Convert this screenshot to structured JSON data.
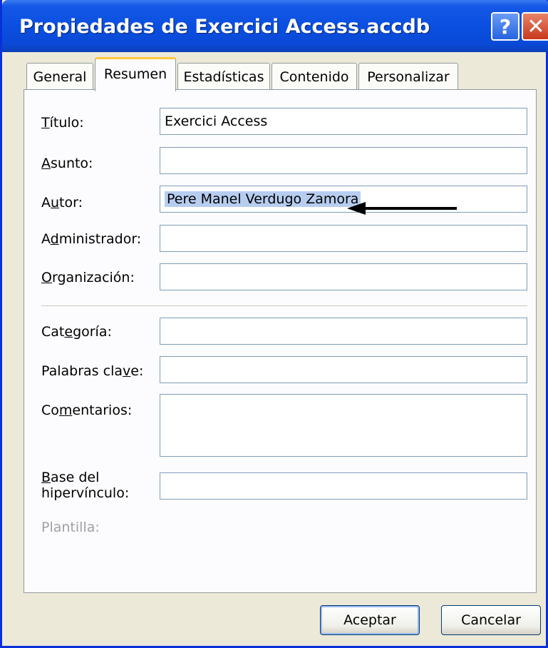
{
  "window": {
    "title": "Propiedades de Exercici Access.accdb",
    "help_glyph": "?",
    "close_glyph": "✕"
  },
  "tabs": [
    "General",
    "Resumen",
    "Estadísticas",
    "Contenido",
    "Personalizar"
  ],
  "fields": {
    "titulo": {
      "label_pre": "",
      "label_u": "T",
      "label_post": "ítulo:",
      "value": "Exercici Access"
    },
    "asunto": {
      "label_pre": "",
      "label_u": "A",
      "label_post": "sunto:",
      "value": ""
    },
    "autor": {
      "label_pre": "A",
      "label_u": "u",
      "label_post": "tor:",
      "value": "Pere Manel Verdugo Zamora"
    },
    "admin": {
      "label_pre": "A",
      "label_u": "d",
      "label_post": "ministrador:",
      "value": ""
    },
    "org": {
      "label_pre": "",
      "label_u": "O",
      "label_post": "rganización:",
      "value": ""
    },
    "categoria": {
      "label_pre": "Cat",
      "label_u": "e",
      "label_post": "goría:",
      "value": ""
    },
    "palabras": {
      "label_pre": "Palabras cla",
      "label_u": "v",
      "label_post": "e:",
      "value": ""
    },
    "coment": {
      "label_pre": "Co",
      "label_u": "m",
      "label_post": "entarios:",
      "value": ""
    },
    "base": {
      "label_line1_u": "B",
      "label_line1_post": "ase del",
      "label_line2": "hipervínculo:",
      "value": ""
    },
    "plantilla": {
      "label": "Plantilla:"
    }
  },
  "buttons": {
    "ok": "Aceptar",
    "cancel": "Cancelar"
  }
}
